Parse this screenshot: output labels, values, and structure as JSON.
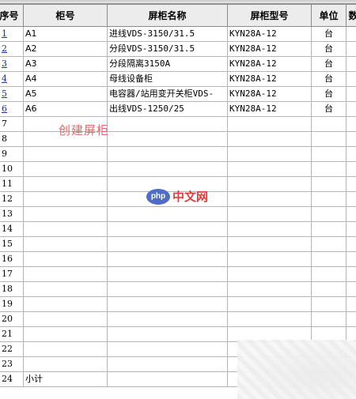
{
  "headers": {
    "no": "序号",
    "cabinet_no": "柜号",
    "name": "屏柜名称",
    "model": "屏柜型号",
    "unit": "单位",
    "qty": "数"
  },
  "rows": [
    {
      "no": "1",
      "cabinet_no": "A1",
      "name": "进线VDS-3150/31.5",
      "model": "KYN28A-12",
      "unit": "台"
    },
    {
      "no": "2",
      "cabinet_no": "A2",
      "name": "分段VDS-3150/31.5",
      "model": "KYN28A-12",
      "unit": "台"
    },
    {
      "no": "3",
      "cabinet_no": "A3",
      "name": "分段隔离3150A",
      "model": "KYN28A-12",
      "unit": "台"
    },
    {
      "no": "4",
      "cabinet_no": "A4",
      "name": "母线设备柜",
      "model": "KYN28A-12",
      "unit": "台"
    },
    {
      "no": "5",
      "cabinet_no": "A5",
      "name": "电容器/站用变开关柜VDS-",
      "model": "KYN28A-12",
      "unit": "台"
    },
    {
      "no": "6",
      "cabinet_no": "A6",
      "name": "出线VDS-1250/25",
      "model": "KYN28A-12",
      "unit": "台"
    }
  ],
  "empty_row_numbers": [
    "7",
    "8",
    "9",
    "10",
    "11",
    "12",
    "13",
    "14",
    "15",
    "16",
    "17",
    "18",
    "19",
    "20",
    "21",
    "22",
    "23"
  ],
  "subtotal": {
    "no": "24",
    "label": "小计"
  },
  "annotation": "创建屏柜",
  "watermark": {
    "logo": "php",
    "text": "中文网"
  },
  "colors": {
    "link": "#1a2fa0",
    "annotation": "#e06a6a",
    "watermark_text": "#e23b3b",
    "watermark_logo": "#4e6cc8"
  }
}
